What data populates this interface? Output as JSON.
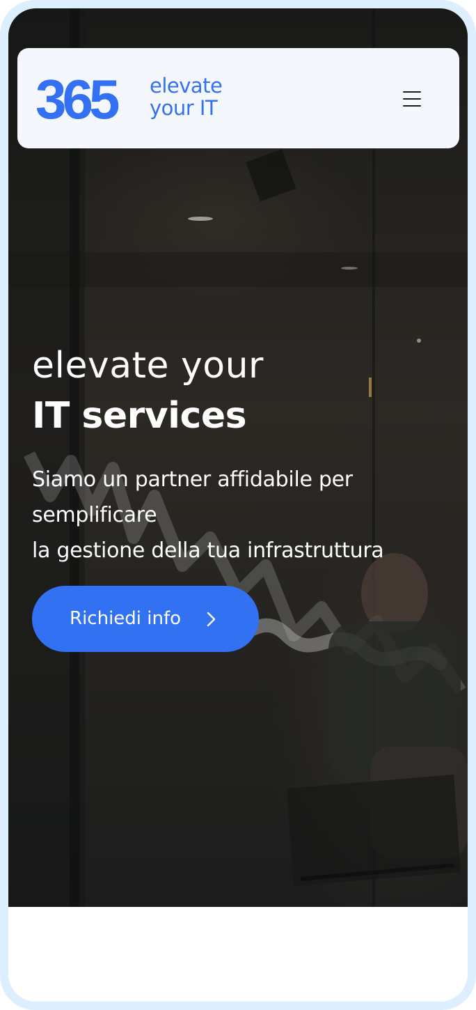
{
  "header": {
    "logo": {
      "number": "365",
      "tagline_line1": "elevate",
      "tagline_line2": "your IT"
    },
    "menu_icon": "hamburger-menu-icon"
  },
  "hero": {
    "title_line1": "elevate your",
    "title_line2": "IT services",
    "subtitle_lines": [
      "Siamo un partner affidabile per",
      "semplificare",
      "la gestione della tua infrastruttura"
    ],
    "cta": {
      "label": "Richiedi info",
      "icon": "chevron-right-icon"
    }
  },
  "colors": {
    "brand_blue": "#3371f2",
    "header_bg": "#f4f8fd",
    "device_frame": "#ddeeff",
    "hero_text": "#ffffff"
  }
}
